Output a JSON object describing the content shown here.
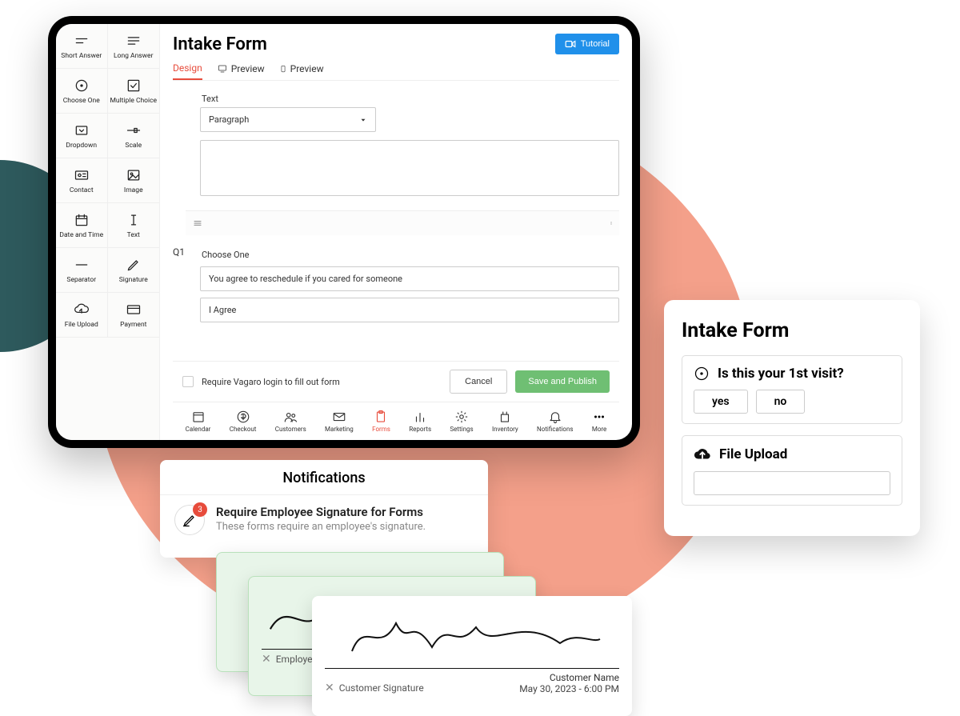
{
  "page_title": "Intake Form",
  "tutorial_btn": "Tutorial",
  "tabs": [
    "Design",
    "Preview",
    "Preview"
  ],
  "palette": [
    "Short Answer",
    "Long Answer",
    "Choose One",
    "Multiple Choice",
    "Dropdown",
    "Scale",
    "Contact",
    "Image",
    "Date and Time",
    "Text",
    "Separator",
    "Signature",
    "File Upload",
    "Payment"
  ],
  "block_text": {
    "label": "Text",
    "select_value": "Paragraph"
  },
  "q1": {
    "num": "Q1",
    "label": "Choose One",
    "prompt": "You agree to reschedule if you cared for someone",
    "option1": "I Agree"
  },
  "footer": {
    "require_login": "Require Vagaro login to fill out form",
    "cancel": "Cancel",
    "save": "Save and Publish"
  },
  "bottom_nav": [
    "Calendar",
    "Checkout",
    "Customers",
    "Marketing",
    "Forms",
    "Reports",
    "Settings",
    "Inventory",
    "Notifications",
    "More"
  ],
  "notifications": {
    "header": "Notifications",
    "badge": "3",
    "item_title": "Require Employee Signature for Forms",
    "item_sub": "These forms require an employee's signature."
  },
  "signature": {
    "employee_label": "Employee",
    "customer_label": "Customer Signature",
    "name_label": "Customer Name",
    "datetime": "May 30, 2023 - 6:00 PM"
  },
  "preview": {
    "title": "Intake Form",
    "q1": "Is this your 1st visit?",
    "opt_yes": "yes",
    "opt_no": "no",
    "file_upload": "File Upload"
  }
}
